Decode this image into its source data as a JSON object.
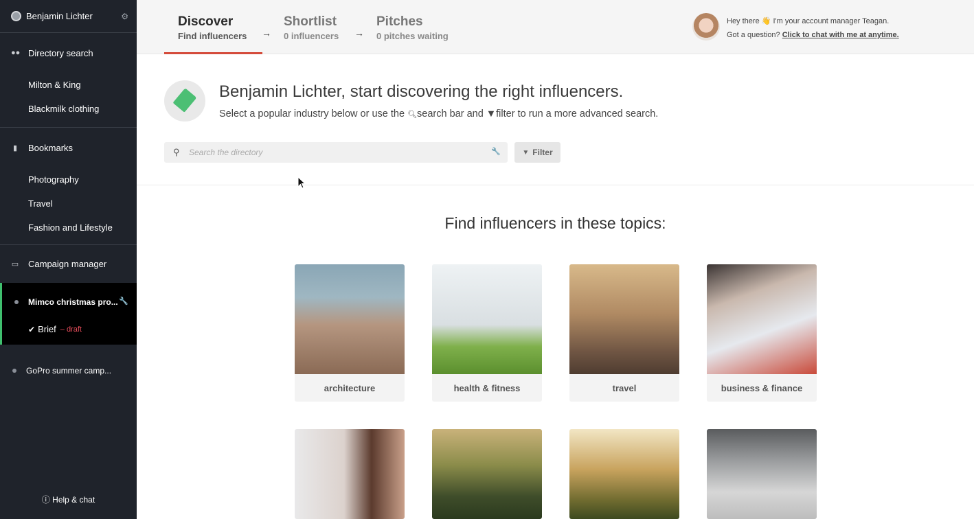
{
  "sidebar": {
    "user": {
      "name": "Benjamin Lichter"
    },
    "directory": {
      "label": "Directory search",
      "items": [
        "Milton & King",
        "Blackmilk clothing"
      ]
    },
    "bookmarks": {
      "label": "Bookmarks",
      "items": [
        "Photography",
        "Travel",
        "Fashion and Lifestyle"
      ]
    },
    "campaigns": {
      "label": "Campaign manager",
      "active": {
        "name": "Mimco christmas pro...",
        "brief_label": "Brief",
        "brief_status": "– draft"
      },
      "other": "GoPro summer camp..."
    },
    "help": "Help & chat"
  },
  "steps": [
    {
      "title": "Discover",
      "subtitle": "Find influencers"
    },
    {
      "title": "Shortlist",
      "subtitle": "0 influencers"
    },
    {
      "title": "Pitches",
      "subtitle": "0 pitches waiting"
    }
  ],
  "manager": {
    "line1": "Hey there 👋 I'm your account manager Teagan.",
    "line2_prefix": "Got a question?",
    "link": "Click to chat with me at anytime."
  },
  "hero": {
    "title": "Benjamin Lichter, start discovering the right influencers.",
    "sub_a": "Select a popular industry below or use the",
    "sub_b": "search bar and",
    "sub_c": "filter to run a more advanced search."
  },
  "search": {
    "placeholder": "Search the directory",
    "filter_label": "Filter"
  },
  "topics": {
    "title": "Find influencers in these topics:",
    "row1": [
      "architecture",
      "health & fitness",
      "travel",
      "business & finance"
    ]
  }
}
